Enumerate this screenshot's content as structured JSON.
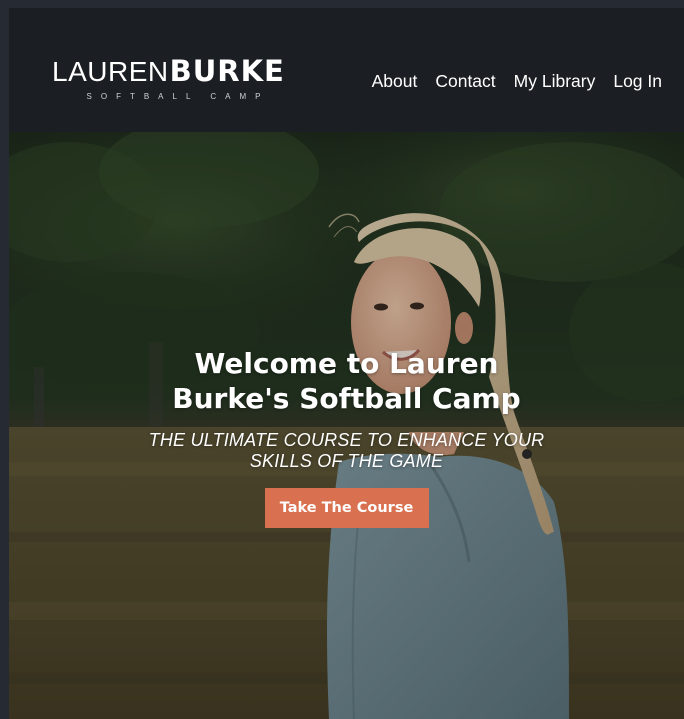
{
  "brand": {
    "first_name": "LAUREN",
    "last_name": "BURKE",
    "tagline": "SOFTBALL CAMP",
    "logo_color": "#ffffff"
  },
  "nav": {
    "items": [
      {
        "label": "About"
      },
      {
        "label": "Contact"
      },
      {
        "label": "My Library"
      },
      {
        "label": "Log In"
      }
    ]
  },
  "hero": {
    "title": "Welcome to Lauren Burke's Softball Camp",
    "subtitle": "THE ULTIMATE COURSE TO ENHANCE YOUR SKILLS OF THE GAME",
    "cta_label": "Take The Course",
    "cta_color": "#d9704f"
  },
  "colors": {
    "navbar_bg": "#1b1e22",
    "page_border": "#262b33",
    "text_light": "#ffffff"
  }
}
